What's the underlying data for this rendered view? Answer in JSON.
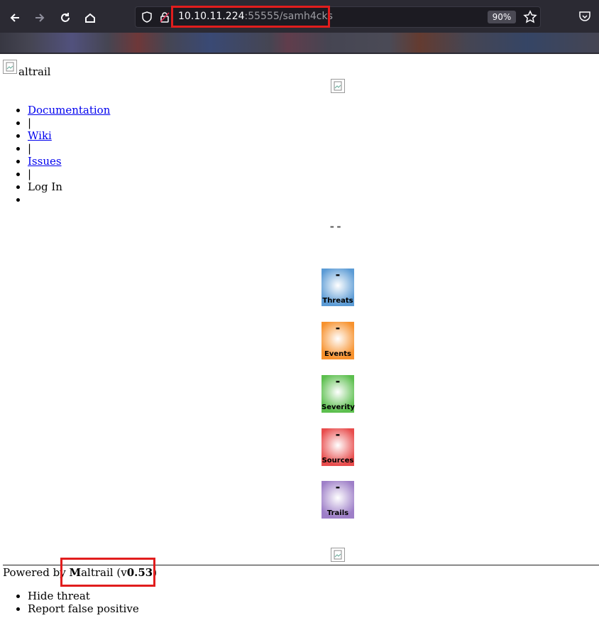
{
  "browser": {
    "url_host": "10.10.11.224",
    "url_path": ":55555/samh4cks",
    "zoom": "90%"
  },
  "logo_suffix": "altrail",
  "nav": {
    "links": [
      "Documentation",
      "|",
      "Wiki",
      "|",
      "Issues",
      "|"
    ],
    "login": "Log In"
  },
  "tiles": [
    {
      "value": "-",
      "label": "Threats",
      "color": "#5b9bd5"
    },
    {
      "value": "-",
      "label": "Events",
      "color": "#f7922e"
    },
    {
      "value": "-",
      "label": "Severity",
      "color": "#5cbf4e"
    },
    {
      "value": "-",
      "label": "Sources",
      "color": "#e84c4c"
    },
    {
      "value": "-",
      "label": "Trails",
      "color": "#9e7fc8"
    }
  ],
  "footer": {
    "powered_prefix": "Powered by ",
    "brand_initial": "M",
    "brand_rest": "altrail",
    "version_open": " (v",
    "version": "0.53",
    "version_close": ")",
    "menu": [
      "Hide threat",
      "Report false positive"
    ]
  }
}
